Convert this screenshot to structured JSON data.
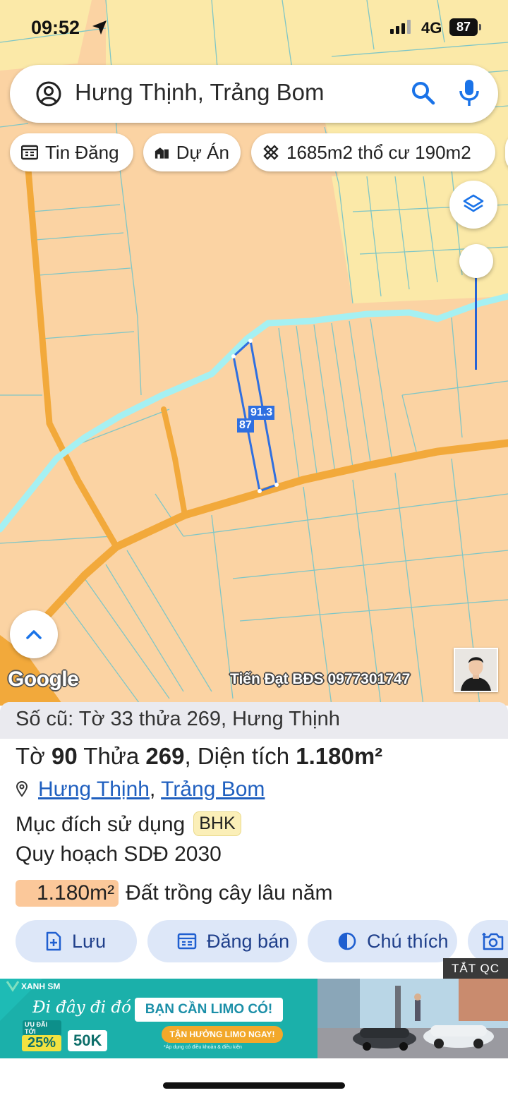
{
  "status_bar": {
    "time": "09:52",
    "network": "4G",
    "battery": "87"
  },
  "search": {
    "query": "Hưng Thịnh, Trảng Bom"
  },
  "chips": [
    {
      "label": "Tin Đăng",
      "icon": "calendar-icon"
    },
    {
      "label": "Dự Án",
      "icon": "building-icon"
    },
    {
      "label": "1685m2 thổ cư 190m2",
      "icon": "measure-icon"
    }
  ],
  "map": {
    "measure_labels": [
      "91.3",
      "87"
    ],
    "attribution": "Google",
    "watermark": "Tiến Đạt BĐS 0977301747",
    "colors": {
      "land": "#fbd3a3",
      "residential": "#fbe9a8",
      "road": "#f2a93b",
      "river": "#a5f0f2",
      "parcel_line": "#7fc6c6",
      "selection": "#2f6fe0"
    }
  },
  "parcel": {
    "old_ref": "Số cũ: Tờ 33 thửa 269, Hưng Thịnh",
    "sheet_label": "Tờ",
    "sheet": "90",
    "lot_label": "Thửa",
    "lot": "269",
    "area_label": "Diện tích",
    "area": "1.180m²",
    "ward": "Hưng Thịnh",
    "district": "Trảng Bom",
    "separator": ",",
    "purpose_label": "Mục đích sử dụng",
    "purpose_code": "BHK",
    "plan_label": "Quy hoạch SDĐ 2030",
    "plan_area": "1.180m²",
    "plan_use": "Đất trồng cây lâu năm"
  },
  "actions": [
    {
      "label": "Lưu",
      "icon": "add-file-icon"
    },
    {
      "label": "Đăng bán",
      "icon": "listing-icon"
    },
    {
      "label": "Chú thích",
      "icon": "contrast-icon"
    },
    {
      "label": "",
      "icon": "camera-icon"
    }
  ],
  "ad": {
    "close_label": "TẮT QC",
    "brand": "XANH SM",
    "slogan": "Đi đây đi đó",
    "headline": "BẠN CẦN LIMO CÓ!",
    "promo_label": "ƯU ĐÃI TỚI",
    "promo_pct": "25%",
    "promo_amt": "50K",
    "cta": "TẬN HƯỞNG LIMO NGAY!",
    "note": "*Áp dụng có điều khoản & điều kiện"
  }
}
